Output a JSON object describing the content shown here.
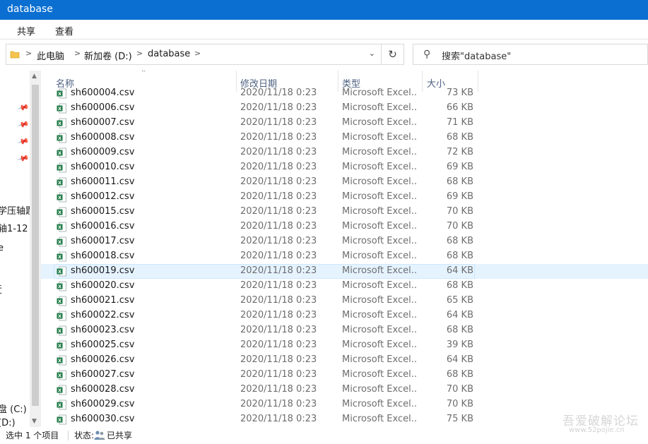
{
  "window": {
    "title": "database"
  },
  "ribbon": {
    "tabs": [
      "共享",
      "查看"
    ]
  },
  "address": {
    "crumbs": [
      "此电脑",
      "新加卷 (D:)",
      "database"
    ],
    "separator": ">",
    "dropdown": "⌄",
    "refresh": "↻"
  },
  "search": {
    "placeholder": "搜索\"database\""
  },
  "nav": {
    "labels": [
      "学压轴题",
      "轴1-12",
      "e",
      "近",
      "盘 (C:)",
      "(D:)"
    ]
  },
  "columns": {
    "name": "名称",
    "date": "修改日期",
    "type": "类型",
    "size": "大小"
  },
  "files": [
    {
      "name": "sh600004.csv",
      "date": "2020/11/18 0:23",
      "type": "Microsoft Excel...",
      "size": "73 KB"
    },
    {
      "name": "sh600006.csv",
      "date": "2020/11/18 0:23",
      "type": "Microsoft Excel...",
      "size": "66 KB"
    },
    {
      "name": "sh600007.csv",
      "date": "2020/11/18 0:23",
      "type": "Microsoft Excel...",
      "size": "71 KB"
    },
    {
      "name": "sh600008.csv",
      "date": "2020/11/18 0:23",
      "type": "Microsoft Excel...",
      "size": "68 KB"
    },
    {
      "name": "sh600009.csv",
      "date": "2020/11/18 0:23",
      "type": "Microsoft Excel...",
      "size": "72 KB"
    },
    {
      "name": "sh600010.csv",
      "date": "2020/11/18 0:23",
      "type": "Microsoft Excel...",
      "size": "69 KB"
    },
    {
      "name": "sh600011.csv",
      "date": "2020/11/18 0:23",
      "type": "Microsoft Excel...",
      "size": "68 KB"
    },
    {
      "name": "sh600012.csv",
      "date": "2020/11/18 0:23",
      "type": "Microsoft Excel...",
      "size": "69 KB"
    },
    {
      "name": "sh600015.csv",
      "date": "2020/11/18 0:23",
      "type": "Microsoft Excel...",
      "size": "70 KB"
    },
    {
      "name": "sh600016.csv",
      "date": "2020/11/18 0:23",
      "type": "Microsoft Excel...",
      "size": "70 KB"
    },
    {
      "name": "sh600017.csv",
      "date": "2020/11/18 0:23",
      "type": "Microsoft Excel...",
      "size": "68 KB"
    },
    {
      "name": "sh600018.csv",
      "date": "2020/11/18 0:23",
      "type": "Microsoft Excel...",
      "size": "68 KB"
    },
    {
      "name": "sh600019.csv",
      "date": "2020/11/18 0:23",
      "type": "Microsoft Excel...",
      "size": "64 KB",
      "selected": true
    },
    {
      "name": "sh600020.csv",
      "date": "2020/11/18 0:23",
      "type": "Microsoft Excel...",
      "size": "68 KB"
    },
    {
      "name": "sh600021.csv",
      "date": "2020/11/18 0:23",
      "type": "Microsoft Excel...",
      "size": "65 KB"
    },
    {
      "name": "sh600022.csv",
      "date": "2020/11/18 0:23",
      "type": "Microsoft Excel...",
      "size": "64 KB"
    },
    {
      "name": "sh600023.csv",
      "date": "2020/11/18 0:23",
      "type": "Microsoft Excel...",
      "size": "68 KB"
    },
    {
      "name": "sh600025.csv",
      "date": "2020/11/18 0:23",
      "type": "Microsoft Excel...",
      "size": "39 KB"
    },
    {
      "name": "sh600026.csv",
      "date": "2020/11/18 0:23",
      "type": "Microsoft Excel...",
      "size": "64 KB"
    },
    {
      "name": "sh600027.csv",
      "date": "2020/11/18 0:23",
      "type": "Microsoft Excel...",
      "size": "68 KB"
    },
    {
      "name": "sh600028.csv",
      "date": "2020/11/18 0:23",
      "type": "Microsoft Excel...",
      "size": "70 KB"
    },
    {
      "name": "sh600029.csv",
      "date": "2020/11/18 0:23",
      "type": "Microsoft Excel...",
      "size": "70 KB"
    },
    {
      "name": "sh600030.csv",
      "date": "2020/11/18 0:23",
      "type": "Microsoft Excel...",
      "size": "75 KB"
    }
  ],
  "status": {
    "selection": "选中 1 个项目",
    "state_label": "状态:",
    "state_value": "已共享"
  },
  "watermark": {
    "main": "吾爱破解论坛",
    "sub": "www.52pojie.cn"
  },
  "colors": {
    "titlebar": "#0a6fd1",
    "selection": "#e5f3ff",
    "excel_green": "#1d7a45"
  }
}
